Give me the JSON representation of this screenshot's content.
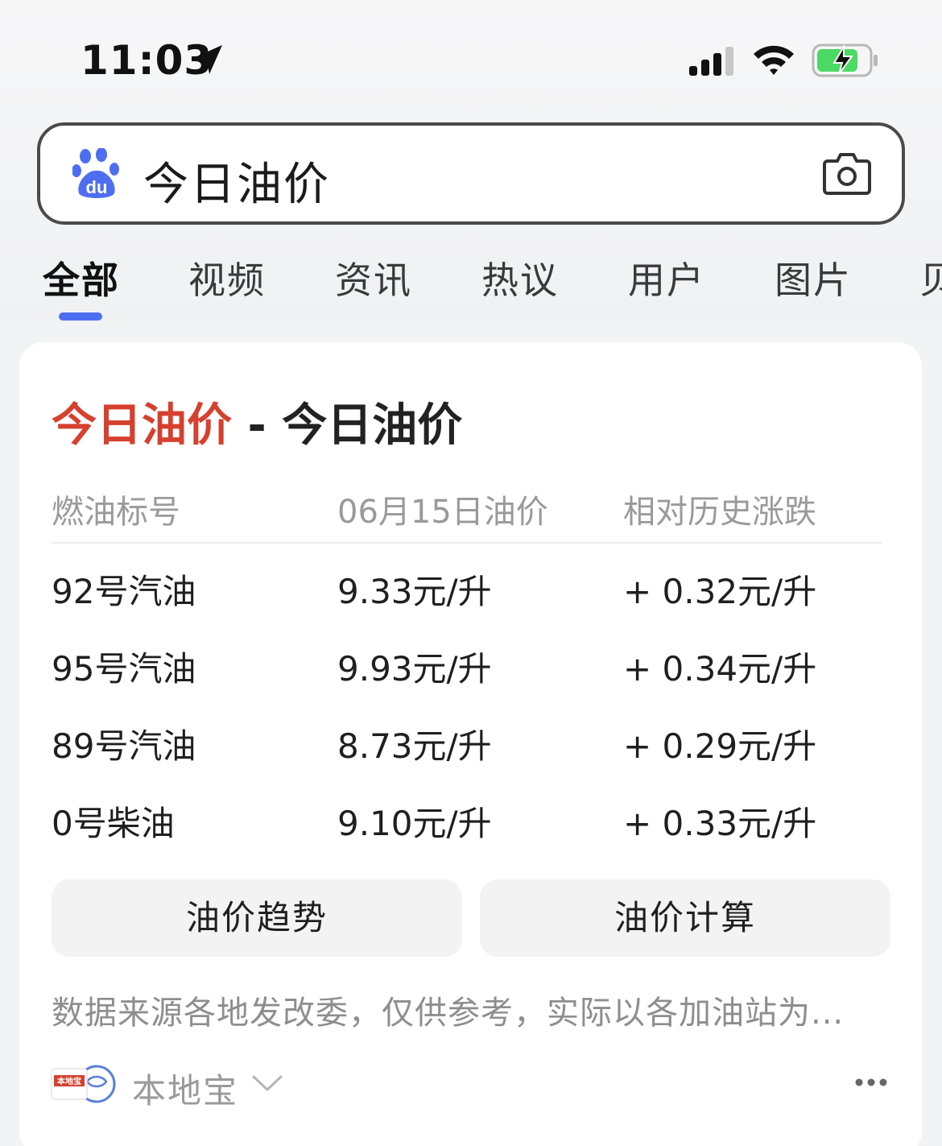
{
  "status_bar": {
    "time": "11:03"
  },
  "search": {
    "query": "今日油价"
  },
  "tabs": [
    {
      "label": "全部",
      "active": true
    },
    {
      "label": "视频"
    },
    {
      "label": "资讯"
    },
    {
      "label": "热议"
    },
    {
      "label": "用户"
    },
    {
      "label": "图片"
    },
    {
      "label": "贝"
    }
  ],
  "card": {
    "title_highlight": "今日油价",
    "title_separator": " - ",
    "title_rest": "今日油价",
    "table": {
      "headers": [
        "燃油标号",
        "06月15日油价",
        "相对历史涨跌"
      ],
      "rows": [
        [
          "92号汽油",
          "9.33元/升",
          "+ 0.32元/升"
        ],
        [
          "95号汽油",
          "9.93元/升",
          "+ 0.34元/升"
        ],
        [
          "89号汽油",
          "8.73元/升",
          "+ 0.29元/升"
        ],
        [
          "0号柴油",
          "9.10元/升",
          "+ 0.33元/升"
        ]
      ]
    },
    "buttons": {
      "trend": "油价趋势",
      "calc": "油价计算"
    },
    "footnote": "数据来源各地发改委，仅供参考，实际以各加油站为...",
    "source": {
      "name": "本地宝",
      "logo_text": "本地宝"
    }
  },
  "colors": {
    "accent": "#4e6ef2",
    "title_highlight": "#d6402f",
    "battery": "#4cd964"
  }
}
